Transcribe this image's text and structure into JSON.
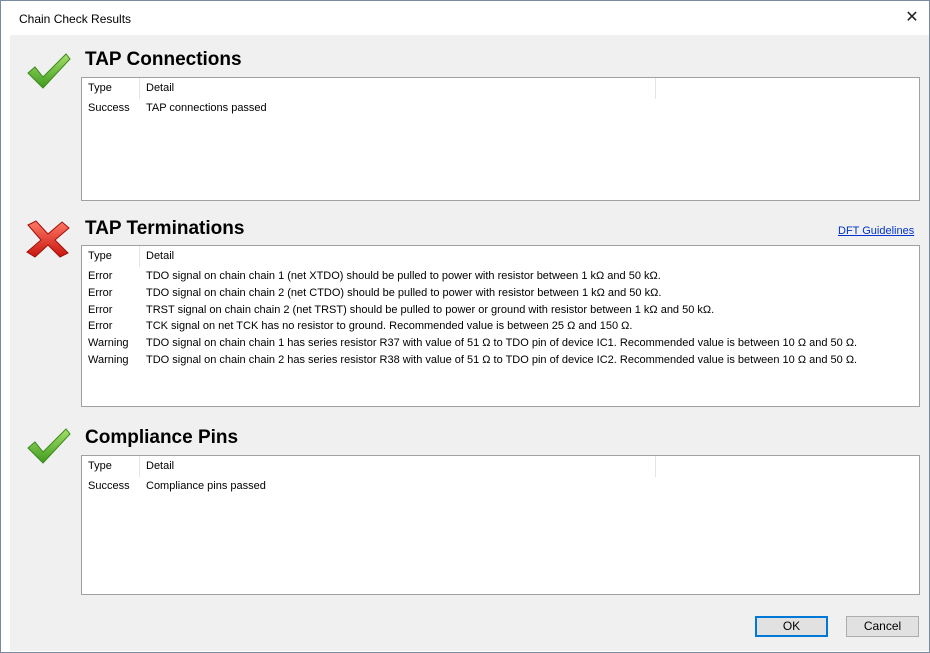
{
  "window": {
    "title": "Chain Check Results",
    "close_glyph": "✕"
  },
  "columns": {
    "type": "Type",
    "detail": "Detail"
  },
  "sections": [
    {
      "title": "TAP Connections",
      "status": "pass",
      "rows": [
        {
          "type": "Success",
          "detail": "TAP connections passed"
        }
      ]
    },
    {
      "title": "TAP Terminations",
      "status": "fail",
      "link": "DFT Guidelines",
      "rows": [
        {
          "type": "Error",
          "detail": "TDO signal on chain chain 1 (net XTDO) should be pulled to power with resistor between 1 kΩ and 50 kΩ."
        },
        {
          "type": "Error",
          "detail": "TDO signal on chain chain 2 (net CTDO) should be pulled to power with resistor between 1 kΩ and 50 kΩ."
        },
        {
          "type": "Error",
          "detail": "TRST signal on chain chain 2 (net TRST) should be pulled to power or ground with resistor between 1 kΩ and 50 kΩ."
        },
        {
          "type": "Error",
          "detail": "TCK signal on net TCK has no resistor to ground. Recommended value is between 25 Ω and 150 Ω."
        },
        {
          "type": "Warning",
          "detail": "TDO signal on chain chain 1 has series resistor R37 with value of 51 Ω to TDO pin of device IC1. Recommended value is between 10 Ω and 50 Ω."
        },
        {
          "type": "Warning",
          "detail": "TDO signal on chain chain 2 has series resistor R38 with value of 51 Ω to TDO pin of device IC2. Recommended value is between 10 Ω and 50 Ω."
        }
      ]
    },
    {
      "title": "Compliance Pins",
      "status": "pass",
      "rows": [
        {
          "type": "Success",
          "detail": "Compliance pins passed"
        }
      ]
    }
  ],
  "buttons": {
    "ok": "OK",
    "cancel": "Cancel"
  },
  "colors": {
    "pass": "#5cb82e",
    "fail": "#e2231a",
    "link": "#0033cc",
    "focus": "#0078d7"
  },
  "icons": {
    "pass": "check-icon",
    "fail": "cross-icon"
  }
}
